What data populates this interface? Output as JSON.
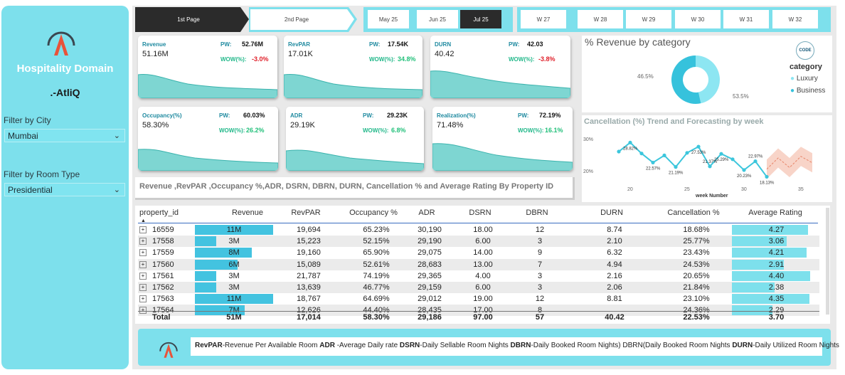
{
  "sidebar": {
    "title": "Hospitality Domain",
    "subtitle": ".-AtliQ",
    "city_filter_label": "Filter by City",
    "city_value": "Mumbai",
    "room_filter_label": "Filter by Room Type",
    "room_value": "Presidential"
  },
  "nav": {
    "page1": "1st Page",
    "page2": "2nd Page"
  },
  "months": [
    "May 25",
    "Jun 25",
    "Jul 25"
  ],
  "selected_month": "Jul 25",
  "weeks": [
    "W 27",
    "W 28",
    "W 29",
    "W 30",
    "W 31",
    "W 32"
  ],
  "kpis": [
    {
      "name": "Revenue",
      "value": "51.16M",
      "pw_label": "PW:",
      "pw": "52.76M",
      "wow_label": "WOW(%):",
      "wow": "-3.0%",
      "wow_color": "#e0202a"
    },
    {
      "name": "RevPAR",
      "value": "17.01K",
      "pw_label": "PW:",
      "pw": "17.54K",
      "wow_label": "WOW(%):",
      "wow": "34.8%",
      "wow_color": "#22c07a"
    },
    {
      "name": "DURN",
      "value": "40.42",
      "pw_label": "PW:",
      "pw": "42.03",
      "wow_label": "WOW(%):",
      "wow": "-3.8%",
      "wow_color": "#e0202a"
    },
    {
      "name": "Occupancy(%)",
      "value": "58.30%",
      "pw_label": "PW:",
      "pw": "60.03%",
      "wow_label": "WOW(%):",
      "wow": "26.2%",
      "wow_color": "#22c07a"
    },
    {
      "name": "ADR",
      "value": "29.19K",
      "pw_label": "PW:",
      "pw": "29.23K",
      "wow_label": "WOW(%):",
      "wow": "6.8%",
      "wow_color": "#22c07a"
    },
    {
      "name": "Realization(%)",
      "value": "71.48%",
      "pw_label": "PW:",
      "pw": "72.19%",
      "wow_label": "WOW(%):",
      "wow": "16.1%",
      "wow_color": "#22c07a"
    }
  ],
  "table_title": "Revenue ,RevPAR ,Occupancy %,ADR, DSRN, DBRN, DURN, Cancellation % and Average Rating By Property ID",
  "table": {
    "columns": [
      "property_id",
      "Revenue",
      "RevPAR",
      "Occupancy %",
      "ADR",
      "DSRN",
      "DBRN",
      "DURN",
      "Cancellation %",
      "Average Rating"
    ],
    "rows": [
      {
        "id": "16559",
        "revenue": "11M",
        "revenue_num": 11,
        "revpar": "19,694",
        "occ": "65.23%",
        "adr": "30,190",
        "dsrn": "18.00",
        "dbrn": "12",
        "durn": "8.74",
        "canc": "18.68%",
        "rating": "4.27",
        "rating_num": 4.27
      },
      {
        "id": "17558",
        "revenue": "3M",
        "revenue_num": 3,
        "revpar": "15,223",
        "occ": "52.15%",
        "adr": "29,190",
        "dsrn": "6.00",
        "dbrn": "3",
        "durn": "2.10",
        "canc": "25.77%",
        "rating": "3.06",
        "rating_num": 3.06
      },
      {
        "id": "17559",
        "revenue": "8M",
        "revenue_num": 8,
        "revpar": "19,160",
        "occ": "65.90%",
        "adr": "29,075",
        "dsrn": "14.00",
        "dbrn": "9",
        "durn": "6.32",
        "canc": "23.43%",
        "rating": "4.21",
        "rating_num": 4.21
      },
      {
        "id": "17560",
        "revenue": "6M",
        "revenue_num": 6,
        "revpar": "15,089",
        "occ": "52.61%",
        "adr": "28,683",
        "dsrn": "13.00",
        "dbrn": "7",
        "durn": "4.94",
        "canc": "24.53%",
        "rating": "2.91",
        "rating_num": 2.91
      },
      {
        "id": "17561",
        "revenue": "3M",
        "revenue_num": 3,
        "revpar": "21,787",
        "occ": "74.19%",
        "adr": "29,365",
        "dsrn": "4.00",
        "dbrn": "3",
        "durn": "2.16",
        "canc": "20.65%",
        "rating": "4.40",
        "rating_num": 4.4
      },
      {
        "id": "17562",
        "revenue": "3M",
        "revenue_num": 3,
        "revpar": "13,639",
        "occ": "46.77%",
        "adr": "29,159",
        "dsrn": "6.00",
        "dbrn": "3",
        "durn": "2.06",
        "canc": "21.84%",
        "rating": "2.38",
        "rating_num": 2.38
      },
      {
        "id": "17563",
        "revenue": "11M",
        "revenue_num": 11,
        "revpar": "18,767",
        "occ": "64.69%",
        "adr": "29,012",
        "dsrn": "19.00",
        "dbrn": "12",
        "durn": "8.81",
        "canc": "23.10%",
        "rating": "4.35",
        "rating_num": 4.35
      },
      {
        "id": "17564",
        "revenue": "7M",
        "revenue_num": 7,
        "revpar": "12,626",
        "occ": "44.40%",
        "adr": "28,435",
        "dsrn": "17.00",
        "dbrn": "8",
        "durn": "",
        "canc": "24.36%",
        "rating": "2.29",
        "rating_num": 2.29
      }
    ],
    "totals": {
      "label": "Total",
      "revenue": "51M",
      "revpar": "17,014",
      "occ": "58.30%",
      "adr": "29,186",
      "dsrn": "97.00",
      "dbrn": "57",
      "durn": "40.42",
      "canc": "22.53%",
      "rating": "3.70"
    }
  },
  "donut": {
    "title": "% Revenue by category",
    "legend_title": "category",
    "badge": "CODE",
    "chart_data": {
      "type": "pie",
      "categories": [
        "Luxury",
        "Business"
      ],
      "values": [
        46.5,
        53.5
      ],
      "labels": [
        "46.5%",
        "53.5%"
      ],
      "colors": [
        "#8de6f2",
        "#36c2dc"
      ]
    }
  },
  "trend": {
    "title": "Cancellation (%) Trend and Forecasting by week",
    "chart_data": {
      "type": "line",
      "xlabel": "week Number",
      "ylabel": "",
      "x_ticks": [
        "20",
        "25",
        "30",
        "35"
      ],
      "y_ticks": [
        "30%",
        "20%"
      ],
      "x": [
        19,
        20,
        21,
        22,
        23,
        24,
        25,
        26,
        27,
        28,
        29,
        30,
        31,
        32
      ],
      "values": [
        26.0,
        28.82,
        25.4,
        22.57,
        24.8,
        21.19,
        25.6,
        27.53,
        21.37,
        25.29,
        23.6,
        20.23,
        22.97,
        18.13
      ],
      "data_labels": [
        {
          "x": 20,
          "text": "28.82%"
        },
        {
          "x": 22,
          "text": "22.57%"
        },
        {
          "x": 24,
          "text": "21.19%"
        },
        {
          "x": 26,
          "text": "27.53%"
        },
        {
          "x": 27,
          "text": "21.37%"
        },
        {
          "x": 28,
          "text": "25.29%"
        },
        {
          "x": 30,
          "text": "20.23%"
        },
        {
          "x": 31,
          "text": "22.97%"
        },
        {
          "x": 32,
          "text": "18.13%"
        }
      ],
      "forecast_x": [
        32,
        33,
        34,
        35,
        36
      ],
      "forecast_values": [
        20.5,
        24.0,
        21.0,
        24.5,
        22.5
      ],
      "color": "#3cc6dc",
      "forecast_color": "#f4b8a4"
    }
  },
  "glossary": [
    {
      "term": "RevPAR",
      "desc": "-Revenue Per Available Room"
    },
    {
      "term": "ADR",
      "desc": " -Average Daily rate"
    },
    {
      "term": "DSRN",
      "desc": "-Daily Sellable Room Nights"
    },
    {
      "term": "DBRN",
      "desc": "-Daily Booked Room Nights) DBRN(Daily Booked Room Nights"
    },
    {
      "term": "DURN",
      "desc": "-Daily Utilized Room Nights"
    }
  ]
}
